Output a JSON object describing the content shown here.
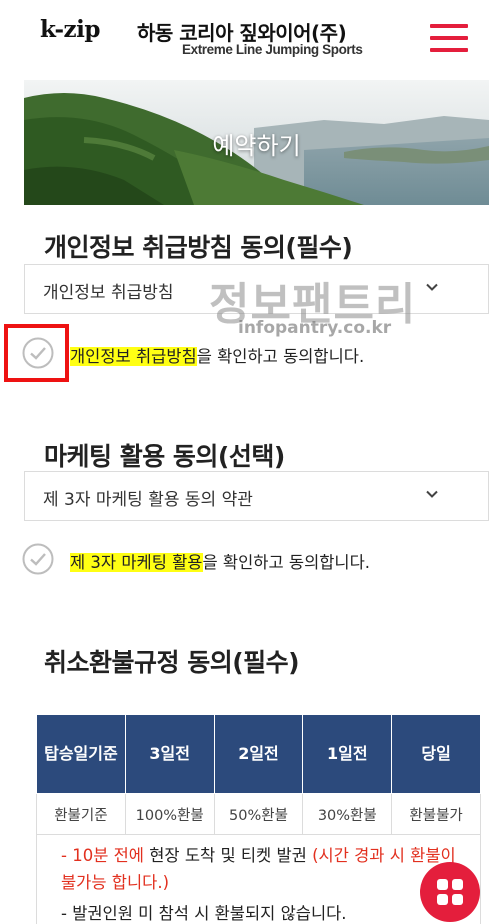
{
  "header": {
    "logo_brand": "k-zip",
    "logo_korean": "하동 코리아 짚와이어(주)",
    "logo_subtitle": "Extreme Line Jumping Sports"
  },
  "hero": {
    "title": "예약하기"
  },
  "privacy": {
    "title": "개인정보 취급방침 동의(필수)",
    "dropdown_label": "개인정보 취급방침",
    "agree_highlight": "개인정보 취급방침",
    "agree_rest": "을 확인하고 동의합니다."
  },
  "marketing": {
    "title": "마케팅 활용 동의(선택)",
    "dropdown_label": "제 3자 마케팅 활용 동의 약관",
    "agree_highlight": "제 3자 마케팅 활용",
    "agree_rest": "을 확인하고 동의합니다."
  },
  "refund": {
    "title": "취소환불규정 동의(필수)",
    "headers": [
      "탑승일기준",
      "3일전",
      "2일전",
      "1일전",
      "당일"
    ],
    "row": [
      "환불기준",
      "100%환불",
      "50%환불",
      "30%환불",
      "환불불가"
    ],
    "note1_prefix": "- ",
    "note1_red_a": "10분 전에",
    "note1_mid": " 현장 도착 및 티켓 발권 ",
    "note1_red_b": "(시간 경과 시 환불이 불가능 합니다.)",
    "note2": "- 발권인원 미 참석 시 환불되지 않습니다."
  },
  "watermark": {
    "main": "정보팬트리",
    "sub": "infopantry.co.kr"
  },
  "colors": {
    "accent": "#e41e3c",
    "table_header": "#2c4a7c",
    "highlight": "#ffff14",
    "red_text": "#e2301f"
  },
  "icons": {
    "menu": "hamburger-icon",
    "dropdown": "chevron-down-icon",
    "check": "check-circle-icon",
    "fab": "grid-menu-icon"
  }
}
